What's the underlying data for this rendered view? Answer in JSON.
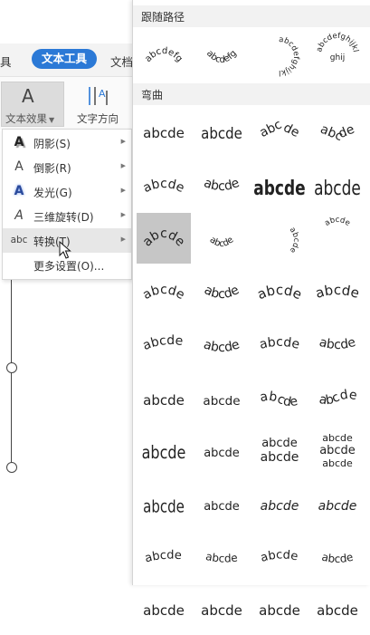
{
  "tabs": {
    "left_partial": "具",
    "text_tools": "文本工具",
    "right_partial": "文档"
  },
  "ribbon": {
    "text_effect_label": "文本效果",
    "text_direction_label": "文字方向",
    "text_effect_glyph": "A"
  },
  "menu": {
    "items": [
      {
        "label": "阴影(S)",
        "icon": "shadow-a-icon",
        "icon_glyph": "A",
        "submenu": true
      },
      {
        "label": "倒影(R)",
        "icon": "reflection-a-icon",
        "icon_glyph": "A",
        "submenu": true
      },
      {
        "label": "发光(G)",
        "icon": "glow-a-icon",
        "icon_glyph": "A",
        "submenu": true
      },
      {
        "label": "三维旋转(D)",
        "icon": "3d-rotate-a-icon",
        "icon_glyph": "A",
        "submenu": true
      },
      {
        "label": "转换(T)",
        "icon": "transform-abc-icon",
        "icon_glyph": "abc",
        "submenu": true,
        "active": true
      },
      {
        "label": "更多设置(O)...",
        "submenu": false
      }
    ]
  },
  "gallery": {
    "section_follow_path": "跟随路径",
    "section_warp": "弯曲",
    "follow_path": [
      {
        "text": "abcdefg",
        "style": "arch-up"
      },
      {
        "text": "abcdefg",
        "style": "arch-down"
      },
      {
        "text": "abcdefghijkl",
        "style": "circle"
      },
      {
        "text": "abcdefghijkl",
        "style": "button"
      }
    ],
    "warp": [
      {
        "text": "abcde",
        "style": "plain"
      },
      {
        "text": "abcde",
        "style": "stop"
      },
      {
        "text": "abcde",
        "style": "triangle-up"
      },
      {
        "text": "abcde",
        "style": "triangle-down"
      },
      {
        "text": "abcde",
        "style": "chevron-up"
      },
      {
        "text": "abcde",
        "style": "chevron-down"
      },
      {
        "text": "abcde",
        "style": "ring-inside"
      },
      {
        "text": "abcde",
        "style": "ring-outside"
      },
      {
        "text": "abcde",
        "style": "arch-up",
        "selected": true
      },
      {
        "text": "abcde",
        "style": "arch-down"
      },
      {
        "text": "abcde",
        "style": "circle"
      },
      {
        "text": "abcde",
        "style": "button"
      },
      {
        "text": "abcde",
        "style": "arch-up-pour"
      },
      {
        "text": "abcde",
        "style": "arch-down-pour"
      },
      {
        "text": "abcde",
        "style": "circle-pour"
      },
      {
        "text": "abcde",
        "style": "button-pour"
      },
      {
        "text": "abcde",
        "style": "curve-up"
      },
      {
        "text": "abcde",
        "style": "curve-down"
      },
      {
        "text": "abcde",
        "style": "can-up"
      },
      {
        "text": "abcde",
        "style": "can-down"
      },
      {
        "text": "abcde",
        "style": "wave-1"
      },
      {
        "text": "abcde",
        "style": "wave-2"
      },
      {
        "text": "abcde",
        "style": "double-wave-1"
      },
      {
        "text": "abcde",
        "style": "double-wave-2"
      },
      {
        "text": "abcde",
        "style": "inflate"
      },
      {
        "text": "abcde",
        "style": "deflate"
      },
      {
        "text": "abcde",
        "style": "inflate-bottom"
      },
      {
        "text": "abcde",
        "style": "deflate-bottom"
      },
      {
        "text": "abcde",
        "style": "inflate-top"
      },
      {
        "text": "abcde",
        "style": "deflate-top"
      },
      {
        "text": "abcde",
        "style": "deflate-inflate"
      },
      {
        "text": "abcde",
        "style": "deflate-inflate-deflate"
      },
      {
        "text": "abcde",
        "style": "fade-right"
      },
      {
        "text": "abcde",
        "style": "fade-left"
      },
      {
        "text": "abcde",
        "style": "fade-up"
      },
      {
        "text": "abcde",
        "style": "fade-down"
      },
      {
        "text": "abcde",
        "style": "slant-up"
      },
      {
        "text": "abcde",
        "style": "slant-down"
      },
      {
        "text": "abcde",
        "style": "cascade-up"
      },
      {
        "text": "abcde",
        "style": "cascade-down"
      }
    ]
  }
}
